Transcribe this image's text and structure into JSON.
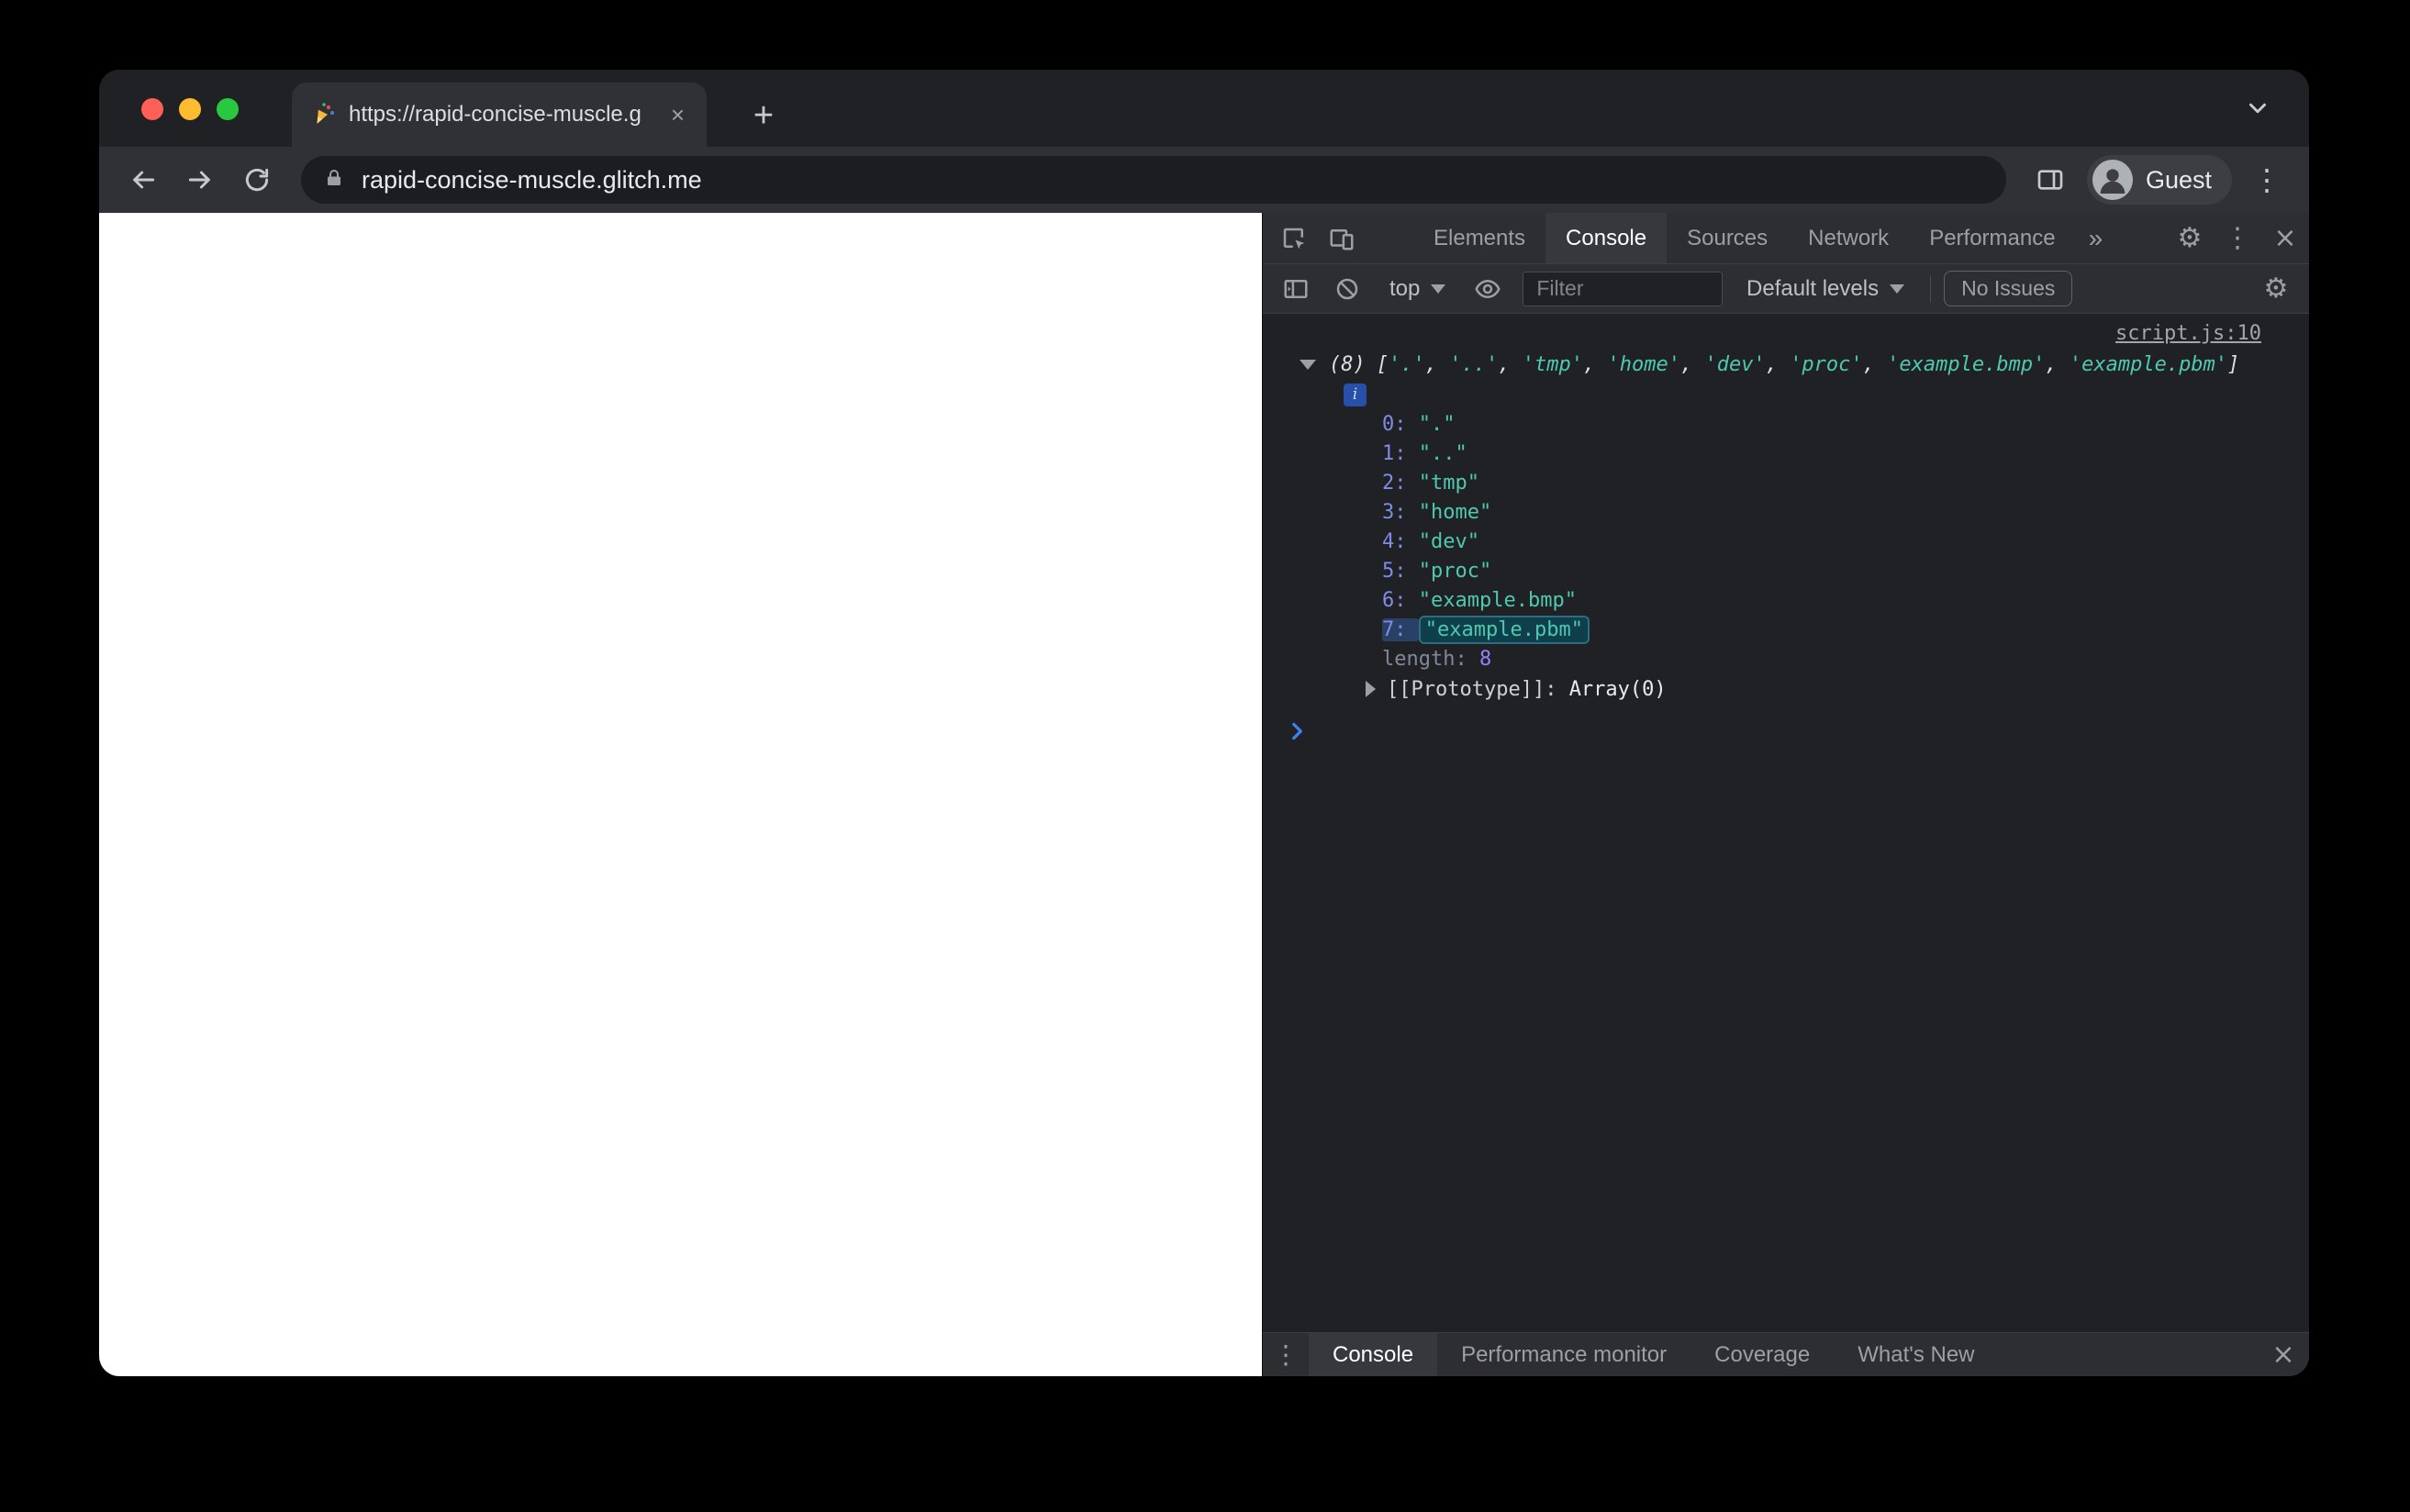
{
  "browser": {
    "tab": {
      "title": "https://rapid-concise-muscle.g"
    },
    "url": "rapid-concise-muscle.glitch.me",
    "guest_label": "Guest"
  },
  "icons": {
    "new_tab": "+",
    "close": "×",
    "gear": "⚙",
    "kebab": "⋮",
    "info": "i",
    "more_tabs": "»"
  },
  "devtools": {
    "tabs": [
      {
        "label": "Elements",
        "active": false
      },
      {
        "label": "Console",
        "active": true
      },
      {
        "label": "Sources",
        "active": false
      },
      {
        "label": "Network",
        "active": false
      },
      {
        "label": "Performance",
        "active": false
      }
    ],
    "toolbar": {
      "context": "top",
      "filter_placeholder": "Filter",
      "levels": "Default levels",
      "issues": "No Issues"
    },
    "console": {
      "source_link": "script.js:10",
      "preview_count": "(8)",
      "items": [
        ".",
        "..",
        "tmp",
        "home",
        "dev",
        "proc",
        "example.bmp",
        "example.pbm"
      ],
      "highlighted_index": 7,
      "length_label": "length",
      "length_value": "8",
      "prototype_label": "[[Prototype]]",
      "prototype_value": "Array(0)"
    },
    "drawer_tabs": [
      {
        "label": "Console",
        "active": true
      },
      {
        "label": "Performance monitor",
        "active": false
      },
      {
        "label": "Coverage",
        "active": false
      },
      {
        "label": "What's New",
        "active": false
      }
    ],
    "colors": {
      "string_teal": "#4ec9b0",
      "index_blue": "#7e8ce8",
      "number_violet": "#9980ff",
      "prompt_blue": "#3e7ff2",
      "traffic_red": "#ff5f57",
      "traffic_yellow": "#febc2e",
      "traffic_green": "#28c840"
    }
  }
}
